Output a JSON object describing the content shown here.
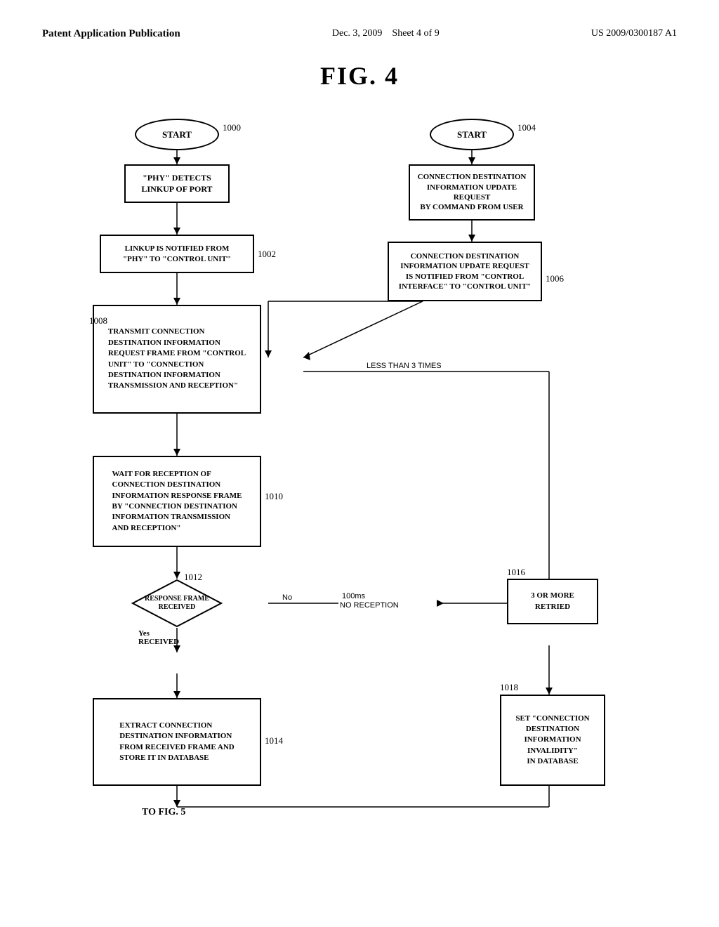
{
  "header": {
    "left": "Patent Application Publication",
    "center_date": "Dec. 3, 2009",
    "center_sheet": "Sheet 4 of 9",
    "right": "US 2009/0300187 A1"
  },
  "figure": {
    "title": "FIG. 4"
  },
  "nodes": {
    "start1": "START",
    "start2": "START",
    "box1000_label": "1000",
    "box1004_label": "1004",
    "box1002_label": "1002",
    "box1006_label": "1006",
    "box1008_label": "1008",
    "box1010_label": "1010",
    "box1012_label": "1012",
    "box1014_label": "1014",
    "box1016_label": "1016",
    "box1018_label": "1018",
    "phy_detects": "\"PHY\" DETECTS\nLINKUP OF PORT",
    "conn_dest_update": "CONNECTION DESTINATION\nINFORMATION UPDATE REQUEST\nBY COMMAND FROM USER",
    "linkup_notified": "LINKUP IS NOTIFIED FROM\n\"PHY\" TO \"CONTROL UNIT\"",
    "conn_update_notified": "CONNECTION DESTINATION\nINFORMATION UPDATE REQUEST\nIS NOTIFIED FROM \"CONTROL\nINTERFACE\" TO \"CONTROL UNIT\"",
    "transmit_conn": "TRANSMIT CONNECTION\nDESTINATION INFORMATION\nREQUEST FRAME FROM \"CONTROL\nUNIT\" TO \"CONNECTION\nDESTINATION INFORMATION\nTRANSMISSION AND RECEPTION\"",
    "wait_reception": "WAIT FOR RECEPTION OF\nCONNECTION DESTINATION\nINFORMATION RESPONSE FRAME\nBY \"CONNECTION DESTINATION\nINFORMATION TRANSMISSION\nAND RECEPTION\"",
    "response_frame": "RESPONSE FRAME\nRECEIVED",
    "no_100ms": "100ms\nNO RECEPTION",
    "three_or_more": "3 OR MORE\nRETRIED",
    "less_than_3": "LESS THAN 3 TIMES",
    "yes_received": "Yes\nRECEIVED",
    "no_label": "No",
    "extract_conn": "EXTRACT CONNECTION\nDESTINATION INFORMATION\nFROM RECEIVED FRAME AND\nSTORE IT IN DATABASE",
    "set_invalidity": "SET \"CONNECTION\nDESTINATION\nINFORMATION\nINVALIDITY\"\nIN DATABASE",
    "to_fig5": "TO FIG. 5"
  }
}
